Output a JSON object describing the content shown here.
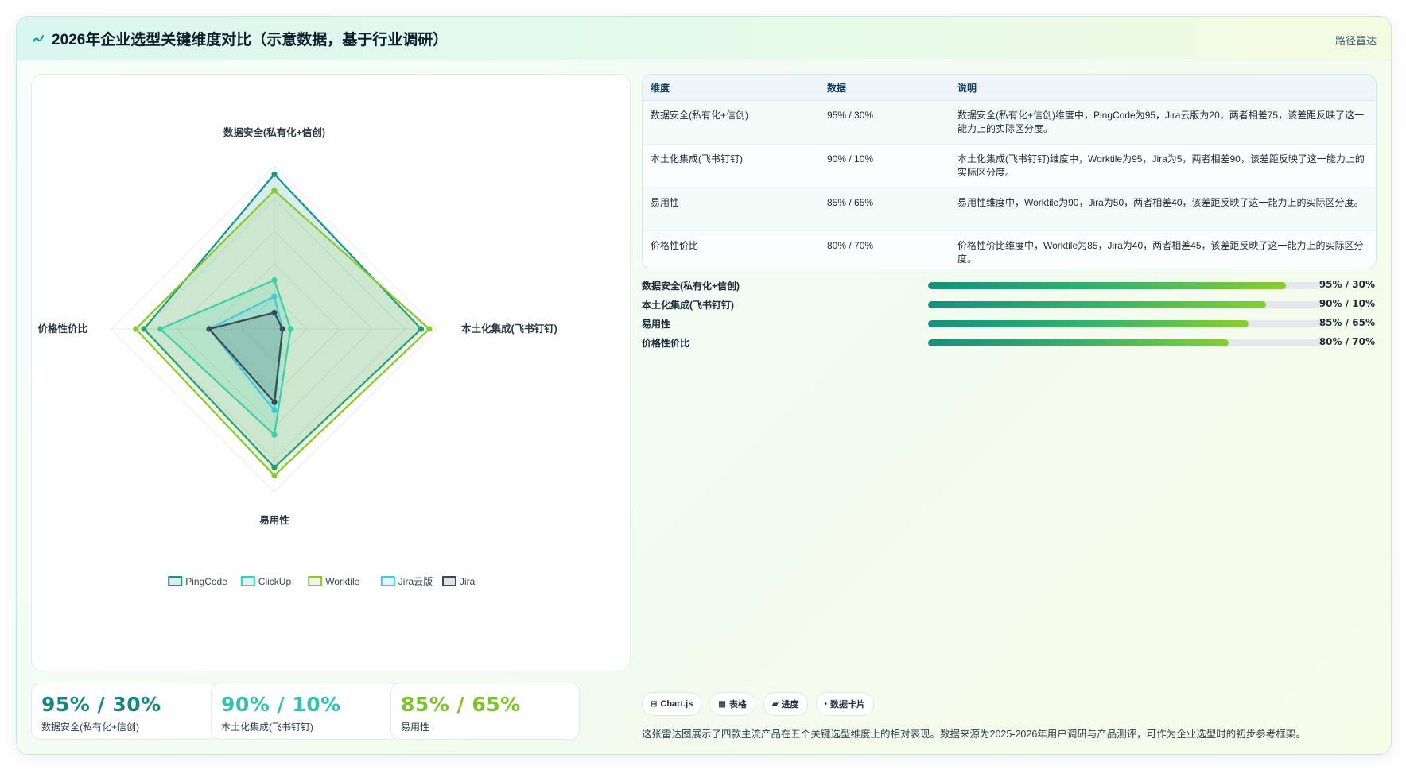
{
  "header": {
    "title": "2026年企业选型关键维度对比（示意数据，基于行业调研）",
    "tag": "路径雷达"
  },
  "chart_data": {
    "type": "radar",
    "axes": [
      "数据安全(私有化+信创)",
      "本土化集成(飞书钉钉)",
      "易用性",
      "价格性价比"
    ],
    "rlim": [
      0,
      100
    ],
    "grid": true,
    "legend_position": "bottom",
    "series": [
      {
        "name": "PingCode",
        "values": [
          95,
          90,
          85,
          80
        ],
        "color": "#14948a"
      },
      {
        "name": "ClickUp",
        "values": [
          30,
          10,
          65,
          70
        ],
        "color": "#2ed1bd"
      },
      {
        "name": "Worktile",
        "values": [
          85,
          95,
          90,
          85
        ],
        "color": "#86c92f"
      },
      {
        "name": "Jira云版",
        "values": [
          20,
          5,
          50,
          40
        ],
        "color": "#46c7dc"
      },
      {
        "name": "Jira",
        "values": [
          10,
          5,
          45,
          40
        ],
        "color": "#3b4a55"
      }
    ]
  },
  "table": {
    "headers": [
      "维度",
      "数据",
      "说明"
    ],
    "rows": [
      {
        "dim": "数据安全(私有化+信创)",
        "data": "95% / 30%",
        "desc": "数据安全(私有化+信创)维度中，PingCode为95，Jira云版为20，两者相差75，该差距反映了这一能力上的实际区分度。"
      },
      {
        "dim": "本土化集成(飞书钉钉)",
        "data": "90% / 10%",
        "desc": "本土化集成(飞书钉钉)维度中，Worktile为95，Jira为5，两者相差90，该差距反映了这一能力上的实际区分度。"
      },
      {
        "dim": "易用性",
        "data": "85% / 65%",
        "desc": "易用性维度中，Worktile为90，Jira为50，两者相差40，该差距反映了这一能力上的实际区分度。"
      },
      {
        "dim": "价格性价比",
        "data": "80% / 70%",
        "desc": "价格性价比维度中，Worktile为85，Jira为40，两者相差45，该差距反映了这一能力上的实际区分度。"
      }
    ]
  },
  "bars": [
    {
      "label": "数据安全(私有化+信创)",
      "value": "95% / 30%",
      "progress": 0.91
    },
    {
      "label": "本土化集成(飞书钉钉)",
      "value": "90% / 10%",
      "progress": 0.86
    },
    {
      "label": "易用性",
      "value": "85% / 65%",
      "progress": 0.815
    },
    {
      "label": "价格性价比",
      "value": "80% / 70%",
      "progress": 0.765
    }
  ],
  "stats": [
    {
      "value": "95% / 30%",
      "label": "数据安全(私有化+信创)",
      "color": "#13897e"
    },
    {
      "value": "90% / 10%",
      "label": "本土化集成(飞书钉钉)",
      "color": "#2fc3b0"
    },
    {
      "value": "85% / 65%",
      "label": "易用性",
      "color": "#7cc22a"
    }
  ],
  "chips": [
    {
      "icon": "grid-icon",
      "glyph": "⊟",
      "label": "Chart.js"
    },
    {
      "icon": "table-icon",
      "glyph": "▦",
      "label": "表格"
    },
    {
      "icon": "progress-icon",
      "glyph": "▰",
      "label": "进度"
    },
    {
      "icon": "card-icon",
      "glyph": "•",
      "label": "数据卡片"
    }
  ],
  "footnote": "这张雷达图展示了四款主流产品在五个关键选型维度上的相对表现。数据来源为2025-2026年用户调研与产品测评，可作为企业选型时的初步参考框架。"
}
